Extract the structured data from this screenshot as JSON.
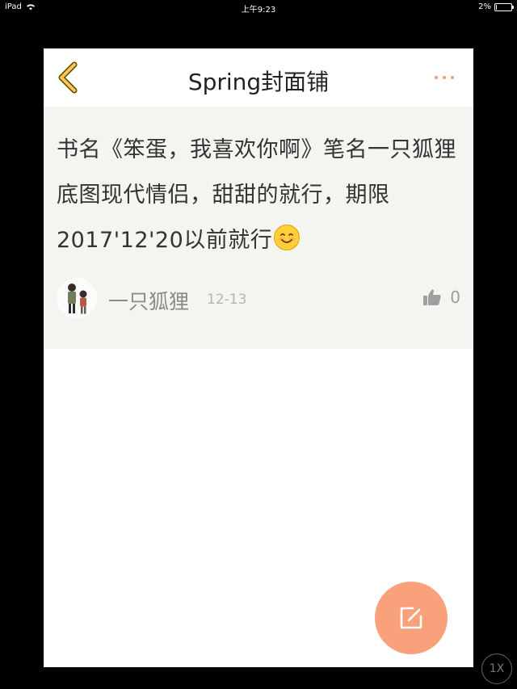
{
  "status_bar": {
    "device": "iPad",
    "time": "上午9:23",
    "battery": "2%",
    "battery_level": 0.02
  },
  "nav": {
    "title": "Spring封面铺",
    "accent_color": "#f59a6c"
  },
  "post": {
    "body": "书名《笨蛋，我喜欢你啊》笔名一只狐狸底图现代情侣，甜甜的就行，期限2017'12'20以前就行",
    "emoji": "smiling-face",
    "author": "一只狐狸",
    "date": "12-13",
    "likes": "0"
  },
  "fab": {
    "icon": "edit-icon",
    "color": "#f8a17b"
  },
  "zoom": {
    "label": "1X"
  }
}
